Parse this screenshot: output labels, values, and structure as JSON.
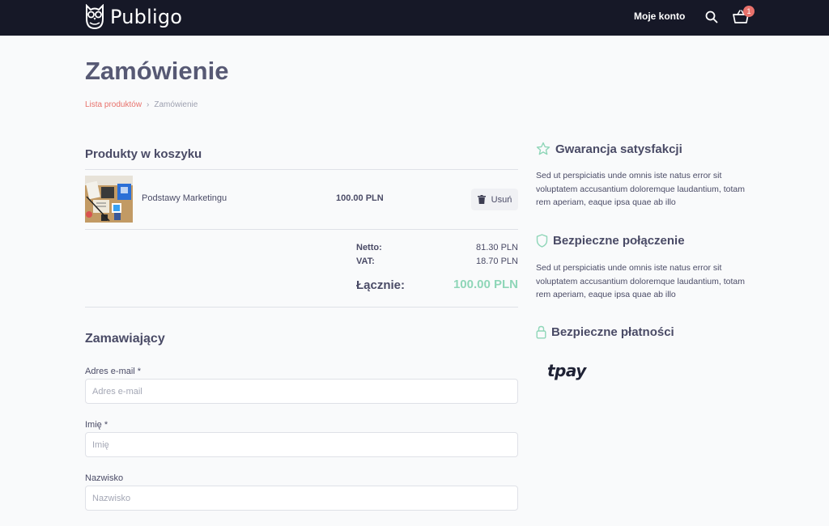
{
  "topbar": {
    "brand": "Publigo",
    "account_label": "Moje konto",
    "search_icon": "search-icon",
    "cart_icon": "basket-icon",
    "cart_count": "1",
    "badge_color": "#e8716b"
  },
  "header": {
    "title": "Zamówienie",
    "breadcrumb": {
      "link": "Lista produktów",
      "separator": "›",
      "current": "Zamówienie"
    }
  },
  "cart": {
    "title": "Produkty w koszyku",
    "items": [
      {
        "name": "Podstawy Marketingu",
        "price": "100.00 PLN",
        "remove_label": "Usuń",
        "remove_icon": "trash-icon"
      }
    ],
    "summary": {
      "net_label": "Netto:",
      "net_value": "81.30 PLN",
      "vat_label": "VAT:",
      "vat_value": "18.70 PLN",
      "total_label": "Łącznie:",
      "total_value": "100.00 PLN",
      "total_color": "#8fd6b8"
    }
  },
  "form": {
    "title": "Zamawiający",
    "fields": [
      {
        "label": "Adres e-mail *",
        "placeholder": "Adres e-mail"
      },
      {
        "label": "Imię *",
        "placeholder": "Imię"
      },
      {
        "label": "Nazwisko",
        "placeholder": "Nazwisko"
      }
    ]
  },
  "sidebar": {
    "blocks": [
      {
        "icon": "star-icon",
        "title": "Gwarancja satysfakcji",
        "text": "Sed ut perspiciatis unde omnis iste natus error sit voluptatem accusantium doloremque laudantium, totam rem aperiam, eaque ipsa quae ab illo"
      },
      {
        "icon": "shield-icon",
        "title": "Bezpieczne połączenie",
        "text": "Sed ut perspiciatis unde omnis iste natus error sit voluptatem accusantium doloremque laudantium, totam rem aperiam, eaque ipsa quae ab illo"
      },
      {
        "icon": "lock-icon",
        "title": "Bezpieczne płatności",
        "payment_logo": "tpay"
      }
    ]
  }
}
